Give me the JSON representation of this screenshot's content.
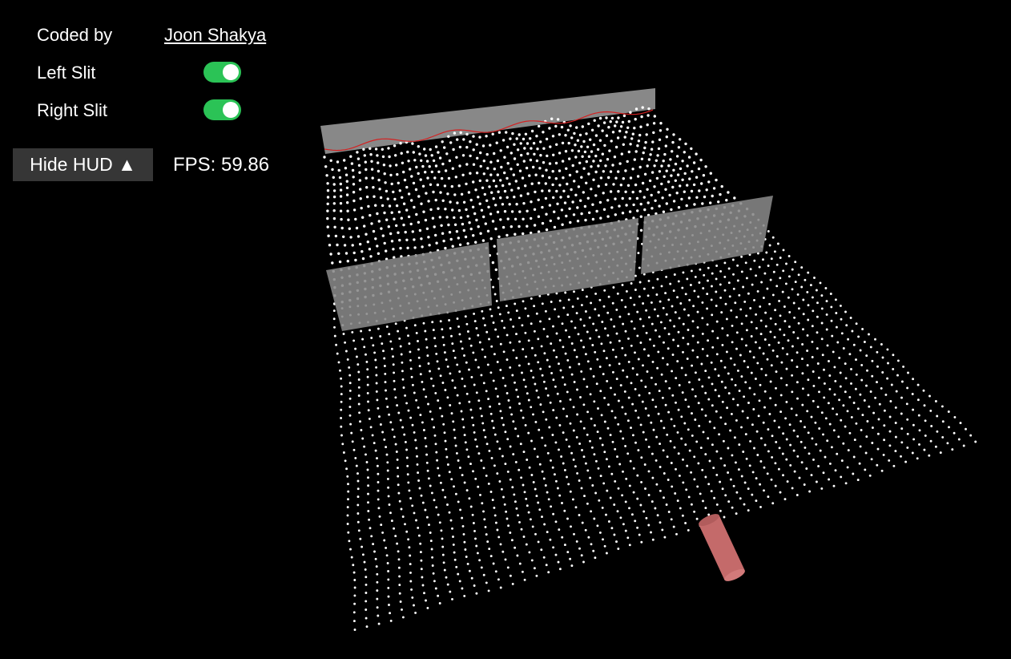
{
  "hud": {
    "credit_label": "Coded by",
    "author_name": "Joon Shakya",
    "left_slit_label": "Left Slit",
    "left_slit_on": true,
    "right_slit_label": "Right Slit",
    "right_slit_on": true,
    "hide_button_label": "Hide HUD ▲",
    "fps_text": "FPS: 59.86"
  },
  "colors": {
    "background": "#000000",
    "toggle_on": "#2bc356",
    "hud_button_bg": "#363636",
    "wall": "#888888",
    "particle": "#ffffff",
    "emitter": "#c46a6a",
    "detector_line": "#d42020"
  }
}
